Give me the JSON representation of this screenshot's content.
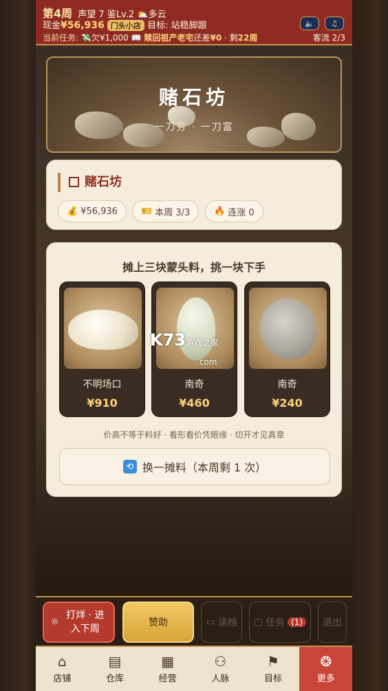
{
  "header": {
    "week": "第4周",
    "reputation": "声望 7",
    "appraisal": "鉴Lv.2",
    "weather": "多云",
    "cash_label": "现金",
    "cash": "¥56,936",
    "shop_badge": "门头小店",
    "goal_label": "目标:",
    "goal": "站稳脚跟",
    "task_label": "当前任务:",
    "debt": "欠¥1,000",
    "task_name": "赎回祖产老宅",
    "task_remain_label": "还差",
    "task_remain": "¥0",
    "weeks_left_label": "· 剩",
    "weeks_left": "22周",
    "customers": "客流 2/3"
  },
  "banner": {
    "title": "赌石坊",
    "subtitle": "一刀穷 · 一刀富"
  },
  "info": {
    "title": "赌石坊",
    "money": "¥56,936",
    "week_count": "本周 3/3",
    "streak": "连涨 0"
  },
  "market": {
    "heading": "摊上三块蒙头料，挑一块下手",
    "stones": [
      {
        "name": "不明场口",
        "price": "¥910"
      },
      {
        "name": "南奇",
        "price": "¥460"
      },
      {
        "name": "南奇",
        "price": "¥240"
      }
    ],
    "hint": "价高不等于料好 · 看形看价凭眼缘 · 切开才见真章",
    "swap_label": "换一摊料（本周剩 1 次）"
  },
  "watermark": {
    "brand": "K73",
    "sub": "游戏之家",
    "domain": ".com"
  },
  "actions": {
    "end_week": "打烊 · 进入下周",
    "sponsor": "赞助",
    "load": "读档",
    "tasks": "任务",
    "tasks_count": "(1)",
    "exit": "退出"
  },
  "nav": [
    {
      "label": "店铺",
      "icon": "shop-icon"
    },
    {
      "label": "仓库",
      "icon": "warehouse-icon"
    },
    {
      "label": "经营",
      "icon": "business-icon"
    },
    {
      "label": "人脉",
      "icon": "contacts-icon"
    },
    {
      "label": "目标",
      "icon": "goal-icon"
    },
    {
      "label": "更多",
      "icon": "more-icon"
    }
  ]
}
